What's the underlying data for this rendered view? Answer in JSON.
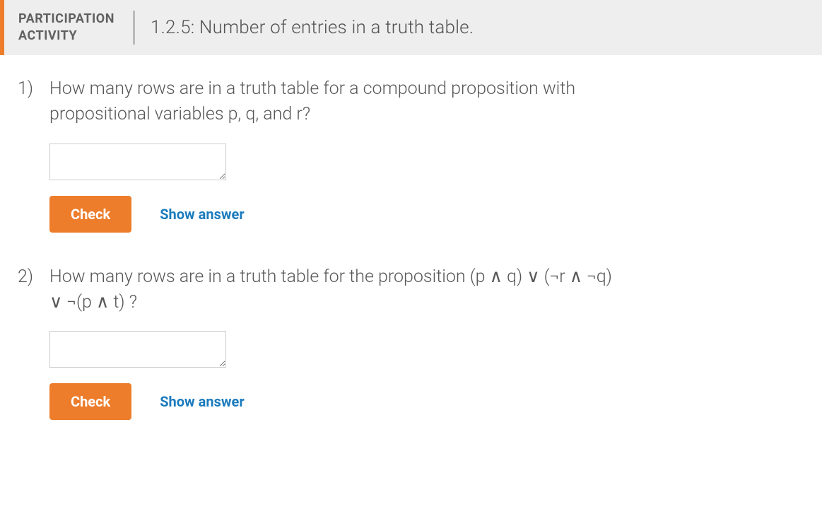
{
  "header": {
    "activity_type": "PARTICIPATION ACTIVITY",
    "title": "1.2.5: Number of entries in a truth table."
  },
  "questions": [
    {
      "number": "1)",
      "text": "How many rows are in a truth table for a compound proposition with propositional variables p, q, and r?",
      "input_value": "",
      "check_label": "Check",
      "show_answer_label": "Show answer"
    },
    {
      "number": "2)",
      "text": "How many rows are in a truth table for the proposition (p ∧ q) ∨ (¬r ∧ ¬q) ∨ ¬(p ∧ t) ?",
      "input_value": "",
      "check_label": "Check",
      "show_answer_label": "Show answer"
    }
  ]
}
